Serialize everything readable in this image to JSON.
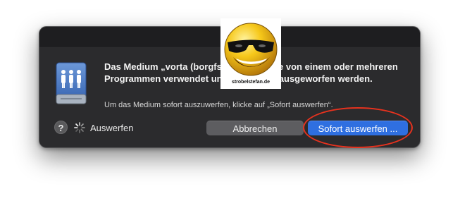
{
  "dialog": {
    "message": "Das Medium „vorta (borgfs)“ wird gerade von einem oder mehreren Programmen verwendet und kann nicht ausgeworfen werden.",
    "submessage": "Um das Medium sofort auszuwerfen, klicke auf „Sofort auswerfen“.",
    "help_label": "?",
    "status_text": "Auswerfen",
    "cancel_label": "Abbrechen",
    "force_label": "Sofort auswerfen ...",
    "icons": {
      "disk": "shared-network-volume-icon",
      "spinner": "progress-spinner-icon",
      "help": "help-icon"
    }
  },
  "watermark": {
    "text": "strobelstefan.de",
    "icon": "sunglasses-smiley-icon"
  },
  "colors": {
    "dialog_bg": "#2b2b2d",
    "accent_button": "#2f6fe0",
    "highlight_ring": "#e8321e"
  }
}
